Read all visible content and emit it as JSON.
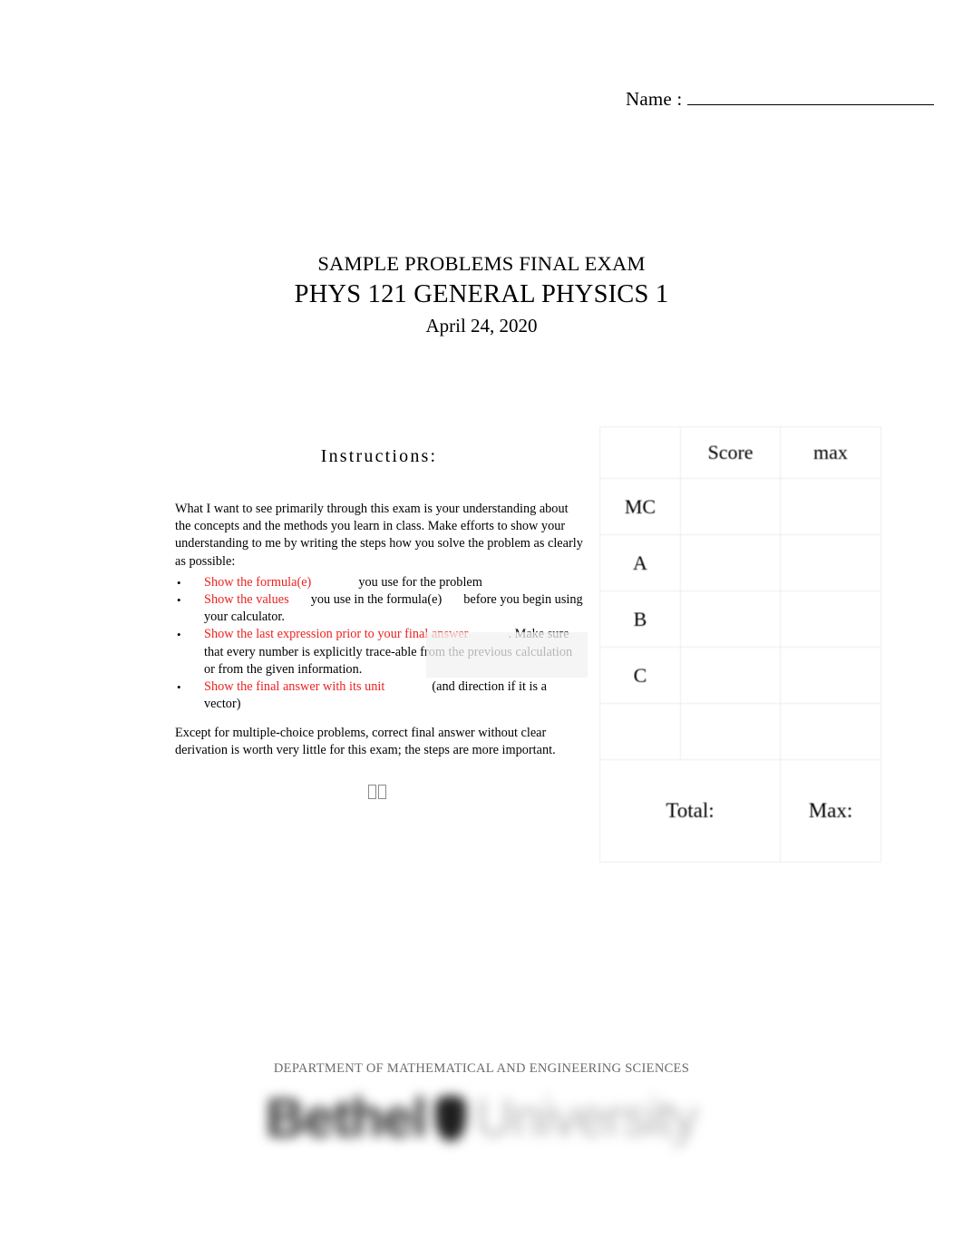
{
  "header": {
    "name_label": "Name :",
    "name_value": ""
  },
  "title": {
    "line1": "SAMPLE PROBLEMS FINAL EXAM",
    "line2": "PHYS 121 GENERAL PHYSICS 1",
    "line3": "April 24, 2020"
  },
  "instructions": {
    "heading": "I n s truc tio n s:",
    "heading_plain": "Instructions:",
    "intro": "What I want to see primarily through this exam is your understanding about the concepts and the methods you learn in class. Make efforts to show your understanding to me by writing the steps how you solve the problem as clearly as possible:",
    "bullets": [
      {
        "red": "Show the formula(e)",
        "rest": "you use for the problem"
      },
      {
        "red": "Show the values",
        "rest": "you use in the formula(e)",
        "rest2": "before you begin using your calculator."
      },
      {
        "red": "Show the last expression prior to your final answer",
        "rest": ". Make sure that every number is explicitly trace-able from the previous calculation or from the given information."
      },
      {
        "red": "Show the final answer with its unit",
        "rest": "(and direction if it is a vector)"
      }
    ],
    "closing": "Except for multiple-choice problems, correct final answer without clear derivation is worth very little for this exam; the steps are more important.",
    "missing_glyphs": "  "
  },
  "score_table": {
    "headers": [
      "",
      "Score",
      "max"
    ],
    "rows": [
      {
        "label": "MC",
        "score": "",
        "max": ""
      },
      {
        "label": "A",
        "score": "",
        "max": ""
      },
      {
        "label": "B",
        "score": "",
        "max": ""
      },
      {
        "label": "C",
        "score": "",
        "max": ""
      },
      {
        "label": "",
        "score": "",
        "max": ""
      }
    ],
    "total_label": "Total:",
    "total_value": "",
    "max_label": "Max:",
    "max_value": ""
  },
  "footer": {
    "department": "DEPARTMENT OF MATHEMATICAL AND ENGINEERING SCIENCES",
    "logo_primary": "Bethel",
    "logo_secondary": "University"
  },
  "colors": {
    "emphasis_red": "#ee2222",
    "footer_gray": "#6b6b6b",
    "table_border": "#ececec"
  }
}
